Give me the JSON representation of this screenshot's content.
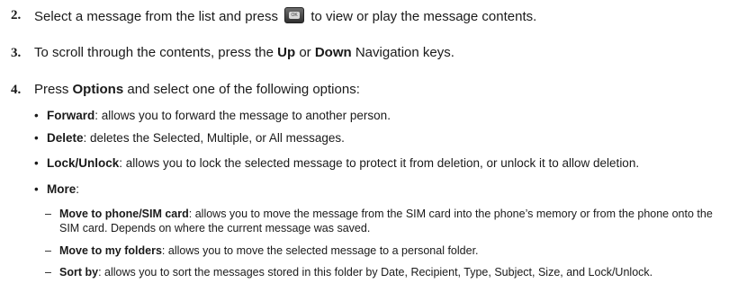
{
  "steps": [
    {
      "number": "2.",
      "text_before": "Select a message from the list and press",
      "key_icon": "ok-key-icon",
      "key_label": "OK",
      "text_after": "to view or play the message contents."
    },
    {
      "number": "3.",
      "text1": "To scroll through the contents, press the ",
      "bold1": "Up",
      "text2": " or ",
      "bold2": "Down",
      "text3": " Navigation keys."
    },
    {
      "number": "4.",
      "text1": "Press ",
      "bold1": "Options",
      "text2": " and select one of the following options:"
    }
  ],
  "bullet_symbol": "•",
  "dash_symbol": "–",
  "options": [
    {
      "term": "Forward",
      "desc": ": allows you to forward the message to another person."
    },
    {
      "term": "Delete",
      "desc": ": deletes the Selected, Multiple, or All messages."
    },
    {
      "term": "Lock/Unlock",
      "desc": ": allows you to lock the selected message to protect it from deletion, or unlock it to allow deletion."
    },
    {
      "term": "More",
      "desc": ":"
    }
  ],
  "more_options": [
    {
      "term": "Move to phone/SIM card",
      "desc": ": allows you to move the message from the SIM card into the phone’s memory or from the phone onto the SIM card. Depends on where the current message was saved."
    },
    {
      "term": "Move to my folders",
      "desc": ": allows you to move the selected message to a personal folder."
    },
    {
      "term": "Sort by",
      "desc": ": allows you to sort the messages stored in this folder by Date, Recipient, Type, Subject, Size, and Lock/Unlock."
    }
  ]
}
